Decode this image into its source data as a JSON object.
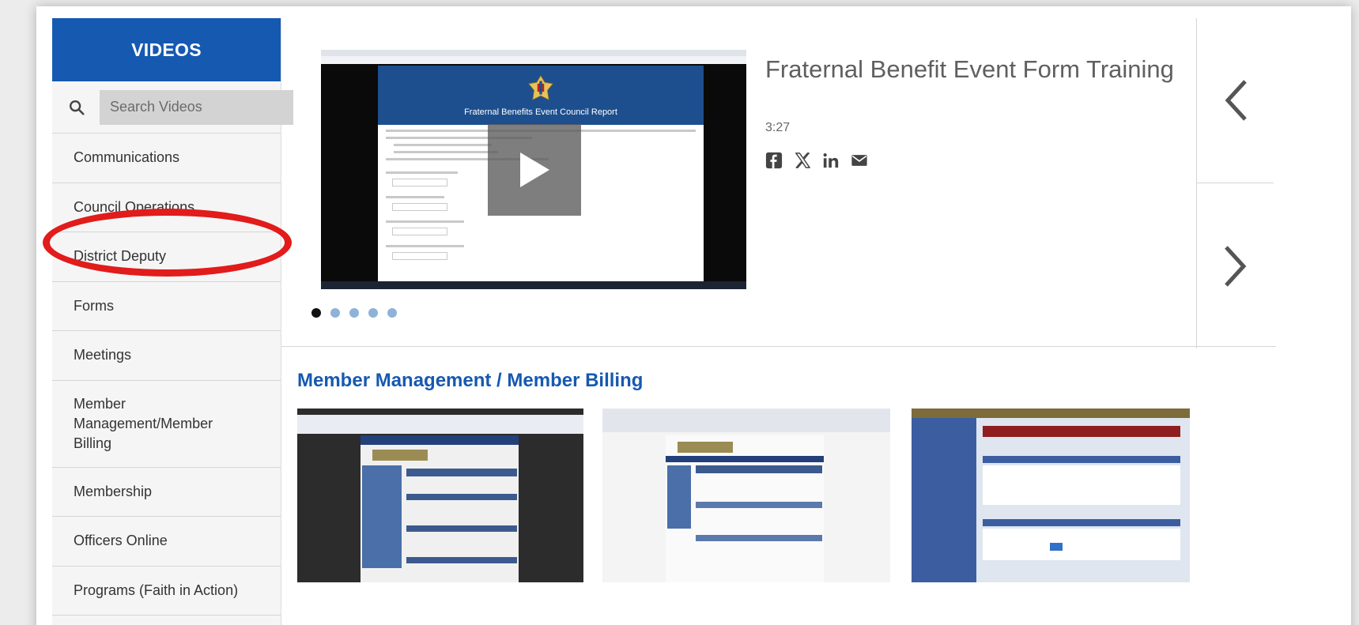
{
  "sidebar": {
    "header": "VIDEOS",
    "search_placeholder": "Search Videos",
    "categories": [
      "Communications",
      "Council Operations",
      "District Deputy",
      "Forms",
      "Meetings",
      "Member Management/Member Billing",
      "Membership",
      "Officers Online",
      "Programs (Faith in Action)"
    ]
  },
  "featured": {
    "title": "Fraternal Benefit Event Form Training",
    "duration": "3:27",
    "video_banner_text": "Fraternal Benefits Event Council Report",
    "share": [
      "facebook-icon",
      "x-icon",
      "linkedin-icon",
      "email-icon"
    ],
    "carousel_dots": 5,
    "active_dot": 1
  },
  "navigation": {
    "prev_icon": "chevron-left-icon",
    "next_icon": "chevron-right-icon"
  },
  "section": {
    "title": "Member Management / Member Billing"
  },
  "colors": {
    "brand_blue": "#1659b0",
    "highlight_red": "#e21b1b",
    "dot_inactive": "#8fb2d9"
  }
}
